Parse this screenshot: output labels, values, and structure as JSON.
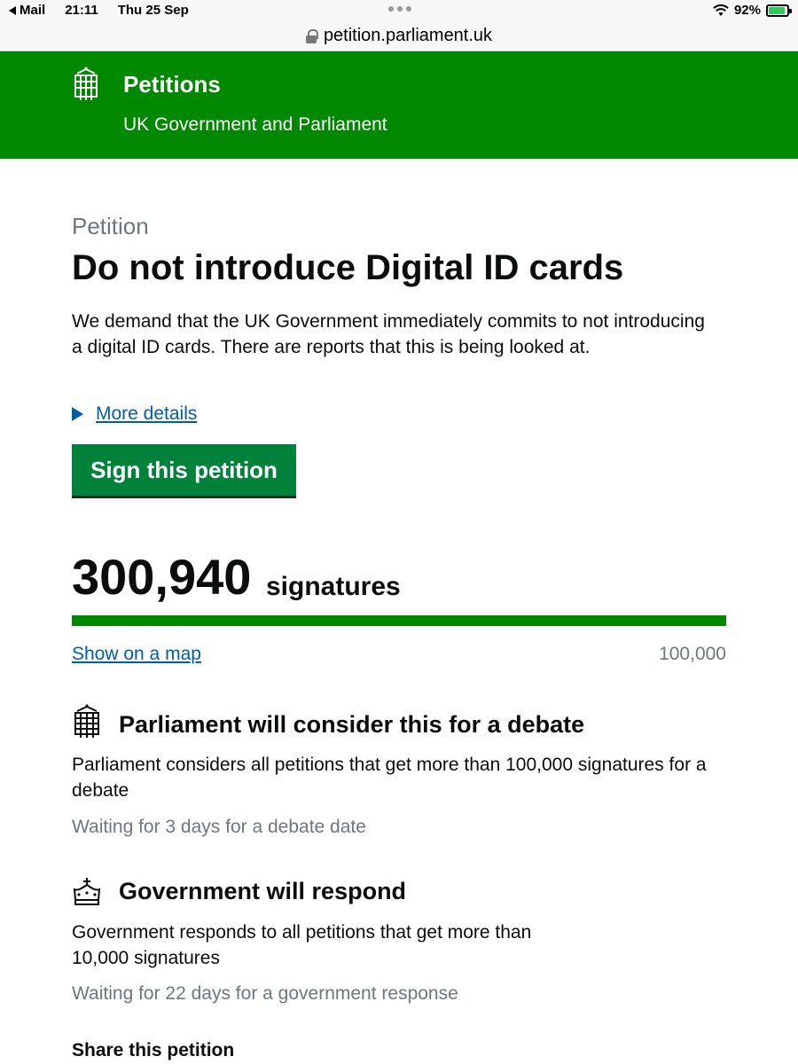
{
  "status_bar": {
    "back_app": "Mail",
    "time": "21:11",
    "date": "Thu 25 Sep",
    "battery": "92%",
    "battery_level": 0.92
  },
  "browser": {
    "url": "petition.parliament.uk"
  },
  "header": {
    "title": "Petitions",
    "subtitle": "UK Government and Parliament"
  },
  "petition": {
    "caption": "Petition",
    "title": "Do not introduce Digital ID cards",
    "description": "We demand that the UK Government immediately commits to not introducing a digital ID cards. There are reports that this is being looked at.",
    "more_details": "More details",
    "sign_button": "Sign this petition"
  },
  "signatures": {
    "count": "300,940",
    "label": "signatures",
    "map_link": "Show on a map",
    "threshold": "100,000",
    "progress_percent": 100
  },
  "milestones": [
    {
      "title": "Parliament will consider this for a debate",
      "body": "Parliament considers all petitions that get more than 100,000 signatures for a debate",
      "waiting": "Waiting for 3 days for a debate date",
      "icon": "portcullis-icon"
    },
    {
      "title": "Government will respond",
      "body": "Government responds to all petitions that get more than 10,000 signatures",
      "waiting": "Waiting for 22 days for a government response",
      "icon": "crown-icon"
    }
  ],
  "share": {
    "heading": "Share this petition"
  },
  "colors": {
    "header_green": "#008800",
    "button_green": "#00823b",
    "link_blue": "#005ea5",
    "secondary_text": "#6f777b"
  }
}
